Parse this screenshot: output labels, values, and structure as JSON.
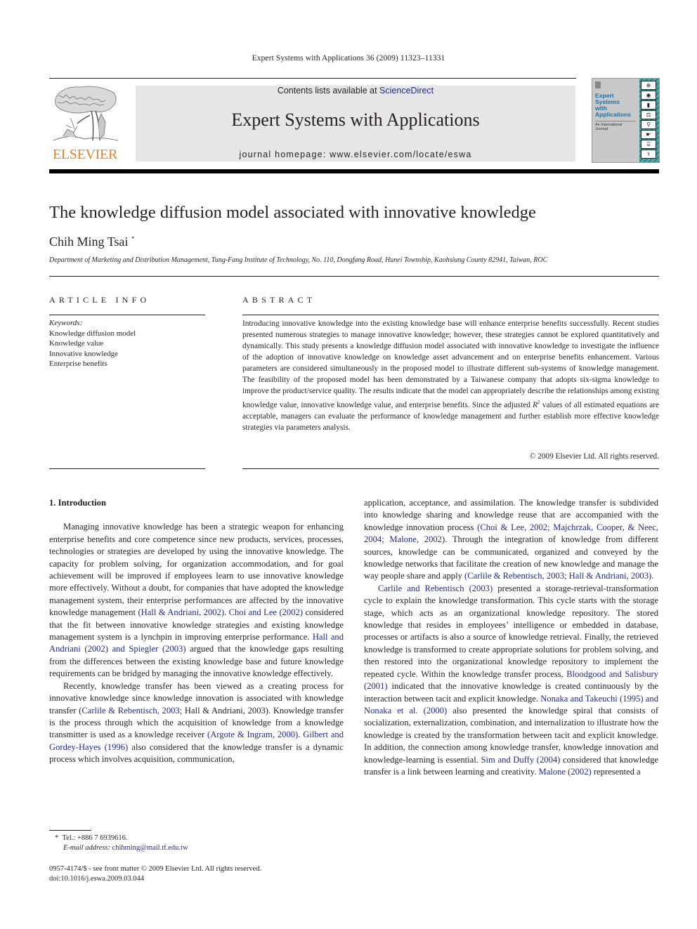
{
  "running_head": "Expert Systems with Applications 36 (2009) 11323–11331",
  "masthead": {
    "contents_prefix": "Contents lists available at ",
    "contents_link": "ScienceDirect",
    "journal_title": "Expert Systems with Applications",
    "homepage": "journal homepage: www.elsevier.com/locate/eswa",
    "publisher_wordmark": "ELSEVIER",
    "cover": {
      "title_lines": [
        "Expert",
        "Systems",
        "with",
        "Applications"
      ],
      "subtitle_lines": [
        "An International",
        "Journal"
      ]
    },
    "colors": {
      "elsevier_orange": "#f07f1c",
      "link_blue": "#1f2a8a",
      "cover_teal": "#2f8e8c",
      "masthead_gray": "#e6e6e6"
    }
  },
  "article": {
    "title": "The knowledge diffusion model associated with innovative knowledge",
    "author": "Chih Ming Tsai",
    "author_mark": "*",
    "affiliation": "Department of Marketing and Distribution Management, Tung-Fang Institute of Technology, No. 110, Dongfang Road, Hunei Township, Kaohsiung County 82941, Taiwan, ROC"
  },
  "article_info": {
    "heading": "ARTICLE INFO",
    "keywords_label": "Keywords:",
    "keywords": [
      "Knowledge diffusion model",
      "Knowledge value",
      "Innovative knowledge",
      "Enterprise benefits"
    ]
  },
  "abstract": {
    "heading": "ABSTRACT",
    "text_before_r2": "Introducing innovative knowledge into the existing knowledge base will enhance enterprise benefits suc­cessfully. Recent studies presented numerous strategies to manage innovative knowledge; however, these strategies cannot be explored quantitatively and dynamically. This study presents a knowledge dif­fusion model associated with innovative knowledge to investigate the influence of the adoption of inno­vative knowledge on knowledge asset advancement and on enterprise benefits enhancement. Various parameters are considered simultaneously in the proposed model to illustrate different sub-systems of knowledge management. The feasibility of the proposed model has been demonstrated by a Taiwanese company that adopts six-sigma knowledge to improve the product/service quality. The results indicate that the model can appropriately describe the relationships among existing knowledge value, innovative knowledge value, and enterprise benefits. Since the adjusted ",
    "r_symbol": "R",
    "r_superscript": "2",
    "text_after_r2": " values of all estimated equations are acceptable, managers can evaluate the performance of knowledge management and further establish more effective knowledge strategies via parameters analysis.",
    "copyright": "© 2009 Elsevier Ltd. All rights reserved."
  },
  "body": {
    "section_heading": "1. Introduction",
    "left": {
      "p1": [
        {
          "t": "Managing innovative knowledge has been a strategic weapon for enhancing enterprise benefits and core competence since new products, services, processes, technologies or strategies are devel­oped by using the innovative knowledge. The capacity for problem solving, for organization accommodation, and for goal achievement will be improved if employees learn to use innovative knowledge more effectively. Without a doubt, for companies that have adopted the knowledge management system, their enterprise per­formances are affected by the innovative knowledge management "
        },
        {
          "c": "(Hall & Andriani, 2002)"
        },
        {
          "t": ". "
        },
        {
          "c": "Choi and Lee (2002)"
        },
        {
          "t": " considered that the fit between innovative knowledge strategies and existing knowledge management system is a lynchpin in improving enterprise perfor­mance. "
        },
        {
          "c": "Hall and Andriani (2002) and Spiegler (2003)"
        },
        {
          "t": " argued that the knowledge gaps resulting from the differences between the existing knowledge base and future knowledge requirements can be bridged by managing the innovative knowledge effectively."
        }
      ],
      "p2": [
        {
          "t": "Recently, knowledge transfer has been viewed as a creating pro­cess for innovative knowledge since knowledge innovation is asso­ciated with knowledge transfer "
        },
        {
          "c": "(Carlile & Rebentisch, 2003;"
        },
        {
          "t": " Hall & Andriani, 2003). Knowledge transfer is the process through which the acquisition of knowledge from a knowledge transmitter is used as a knowledge receiver "
        },
        {
          "c": "(Argote & Ingram, 2000)"
        },
        {
          "t": ". "
        },
        {
          "c": "Gilbert and Gor­dey-Hayes (1996)"
        },
        {
          "t": " also considered that the knowledge transfer is a dynamic process which involves acquisition, communication,"
        }
      ]
    },
    "right": {
      "p1": [
        {
          "t": "application, acceptance, and assimilation. The knowledge transfer is subdivided into knowledge sharing and knowledge reuse that are accompanied with the knowledge innovation process "
        },
        {
          "c": "(Choi & Lee, 2002; Majchrzak, Cooper, & Neec, 2004; Malone, 2002)"
        },
        {
          "t": ". Through the integration of knowledge from different sources, knowledge can be communicated, organized and conveyed by the knowledge networks that facilitate the creation of new knowl­edge and manage the way people share and apply "
        },
        {
          "c": "(Carlile & Reben­tisch, 2003; Hall & Andriani, 2003)"
        },
        {
          "t": "."
        }
      ],
      "p2": [
        {
          "c": "Carlile and Rebentisch (2003)"
        },
        {
          "t": " presented a storage-retrieval-transformation cycle to explain the knowledge transformation. This cycle starts with the storage stage, which acts as an organiza­tional knowledge repository. The stored knowledge that resides in employees’ intelligence or embedded in database, processes or artifacts is also a source of knowledge retrieval. Finally, the re­trieved knowledge is transformed to create appropriate solutions for problem solving, and then restored into the organizational knowledge repository to implement the repeated cycle. Within the knowledge transfer process, "
        },
        {
          "c": "Bloodgood and Salisbury (2001)"
        },
        {
          "t": " indicated that the innovative knowledge is created continuously by the interaction between tacit and explicit knowledge. "
        },
        {
          "c": "Nonaka and Takeuchi (1995) and Nonaka et al. (2000)"
        },
        {
          "t": " also presented the knowledge spiral that consists of socialization, externalization, combination, and internalization to illustrate how the knowledge is created by the transformation between tacit and explicit knowl­edge. In addition, the connection among knowledge transfer, knowledge innovation and knowledge-learning is essential. "
        },
        {
          "c": "Sim and Duffy (2004)"
        },
        {
          "t": " considered that knowledge transfer is a link between learning and creativity. "
        },
        {
          "c": "Malone (2002)"
        },
        {
          "t": " represented a"
        }
      ]
    }
  },
  "footnote": {
    "mark": "*",
    "tel": "Tel.: +886 7 6939616.",
    "email_label": "E-mail address:",
    "email": "chihming@mail.tf.edu.tw"
  },
  "front_matter": {
    "issn_line": "0957-4174/$ - see front matter © 2009 Elsevier Ltd. All rights reserved.",
    "doi": "doi:10.1016/j.eswa.2009.03.044"
  }
}
